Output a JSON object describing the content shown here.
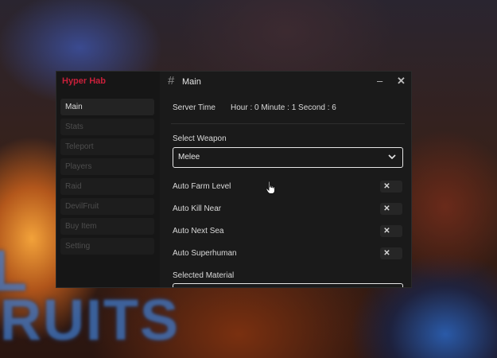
{
  "background": {
    "letters_line1": "L",
    "letters_line2": "RUITS"
  },
  "app": {
    "name": "Hyper Hab",
    "brand_color": "#c8203a"
  },
  "sidebar": {
    "items": [
      {
        "label": "Main",
        "active": true
      },
      {
        "label": "Stats"
      },
      {
        "label": "Teleport"
      },
      {
        "label": "Players"
      },
      {
        "label": "Raid"
      },
      {
        "label": "DevilFruit"
      },
      {
        "label": "Buy Item"
      },
      {
        "label": "Setting"
      }
    ]
  },
  "header": {
    "icon": "hash-icon",
    "title": "Main",
    "minimize_glyph": "–",
    "close_glyph": "✕"
  },
  "server_time": {
    "label": "Server Time",
    "value": "Hour : 0 Minute : 1 Second : 6"
  },
  "weapon": {
    "label": "Select Weapon",
    "selected": "Melee",
    "icon": "chevron-down-icon"
  },
  "toggles": [
    {
      "label": "Auto Farm Level",
      "on": false,
      "glyph": "✕"
    },
    {
      "label": "Auto Kill Near",
      "on": false,
      "glyph": "✕"
    },
    {
      "label": "Auto Next Sea",
      "on": false,
      "glyph": "✕"
    },
    {
      "label": "Auto Superhuman",
      "on": false,
      "glyph": "✕"
    }
  ],
  "material": {
    "label": "Selected Material"
  }
}
